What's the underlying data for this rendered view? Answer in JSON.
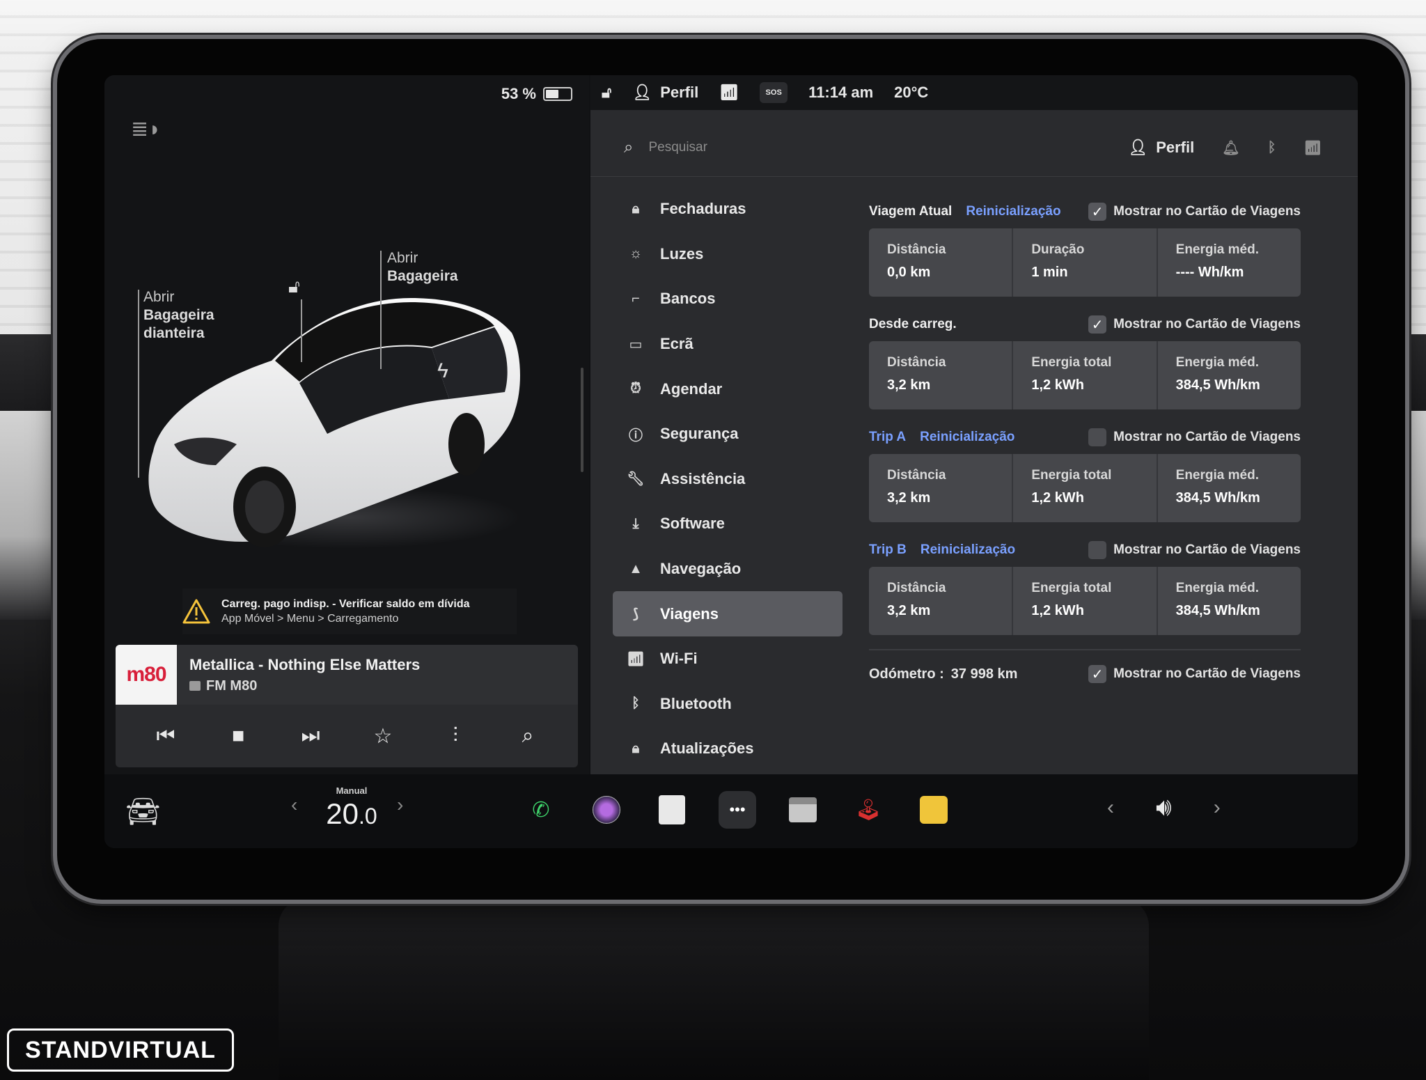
{
  "status": {
    "battery_pct": "53 %",
    "battery_level": 0.53,
    "profile": "Perfil",
    "sos": "SOS",
    "time": "11:14 am",
    "temp": "20°C"
  },
  "vehicle": {
    "front_trunk": [
      "Abrir",
      "Bagageira",
      "dianteira"
    ],
    "rear_trunk": [
      "Abrir",
      "Bagageira"
    ]
  },
  "alert": {
    "title": "Carreg. pago indisp. - Verificar saldo em dívida",
    "path": "App Móvel > Menu > Carregamento"
  },
  "media": {
    "title": "Metallica - Nothing Else Matters",
    "station": "FM M80",
    "logo_text": "m80"
  },
  "search": {
    "placeholder": "Pesquisar",
    "profile": "Perfil"
  },
  "menu": [
    {
      "label": "Fechaduras",
      "icon": "lock-icon"
    },
    {
      "label": "Luzes",
      "icon": "sun-icon"
    },
    {
      "label": "Bancos",
      "icon": "seat-icon"
    },
    {
      "label": "Ecrã",
      "icon": "display-icon"
    },
    {
      "label": "Agendar",
      "icon": "alarm-icon"
    },
    {
      "label": "Segurança",
      "icon": "safety-icon"
    },
    {
      "label": "Assistência",
      "icon": "wrench-icon"
    },
    {
      "label": "Software",
      "icon": "download-icon"
    },
    {
      "label": "Navegação",
      "icon": "navigation-icon"
    },
    {
      "label": "Viagens",
      "icon": "trips-icon",
      "active": true
    },
    {
      "label": "Wi-Fi",
      "icon": "wifi-icon"
    },
    {
      "label": "Bluetooth",
      "icon": "bluetooth-icon"
    },
    {
      "label": "Atualizações",
      "icon": "updates-icon"
    }
  ],
  "trips": {
    "show_label": "Mostrar no Cartão de Viagens",
    "reset_label": "Reinicialização",
    "current": {
      "title": "Viagem Atual",
      "checked": true,
      "stats": [
        {
          "label": "Distância",
          "value": "0,0 km"
        },
        {
          "label": "Duração",
          "value": "1 min"
        },
        {
          "label": "Energia méd.",
          "value": "---- Wh/km"
        }
      ]
    },
    "since_charge": {
      "title": "Desde carreg.",
      "checked": true,
      "stats": [
        {
          "label": "Distância",
          "value": "3,2 km"
        },
        {
          "label": "Energia total",
          "value": "1,2 kWh"
        },
        {
          "label": "Energia méd.",
          "value": "384,5 Wh/km"
        }
      ]
    },
    "trip_a": {
      "title": "Trip A",
      "checked": false,
      "stats": [
        {
          "label": "Distância",
          "value": "3,2 km"
        },
        {
          "label": "Energia total",
          "value": "1,2 kWh"
        },
        {
          "label": "Energia méd.",
          "value": "384,5 Wh/km"
        }
      ]
    },
    "trip_b": {
      "title": "Trip B",
      "checked": false,
      "stats": [
        {
          "label": "Distância",
          "value": "3,2 km"
        },
        {
          "label": "Energia total",
          "value": "1,2 kWh"
        },
        {
          "label": "Energia méd.",
          "value": "384,5 Wh/km"
        }
      ]
    },
    "odometer": {
      "label": "Odómetro :",
      "value": "37 998 km",
      "checked": true
    }
  },
  "dock": {
    "climate_mode": "Manual",
    "temp_whole": "20",
    "temp_decimal": ".0"
  },
  "watermark": "STANDVIRTUAL",
  "colors": {
    "accent_link": "#7aa0ff",
    "panel": "#2a2b2e",
    "stat_box": "#46474b",
    "menu_active": "#5a5b60"
  }
}
